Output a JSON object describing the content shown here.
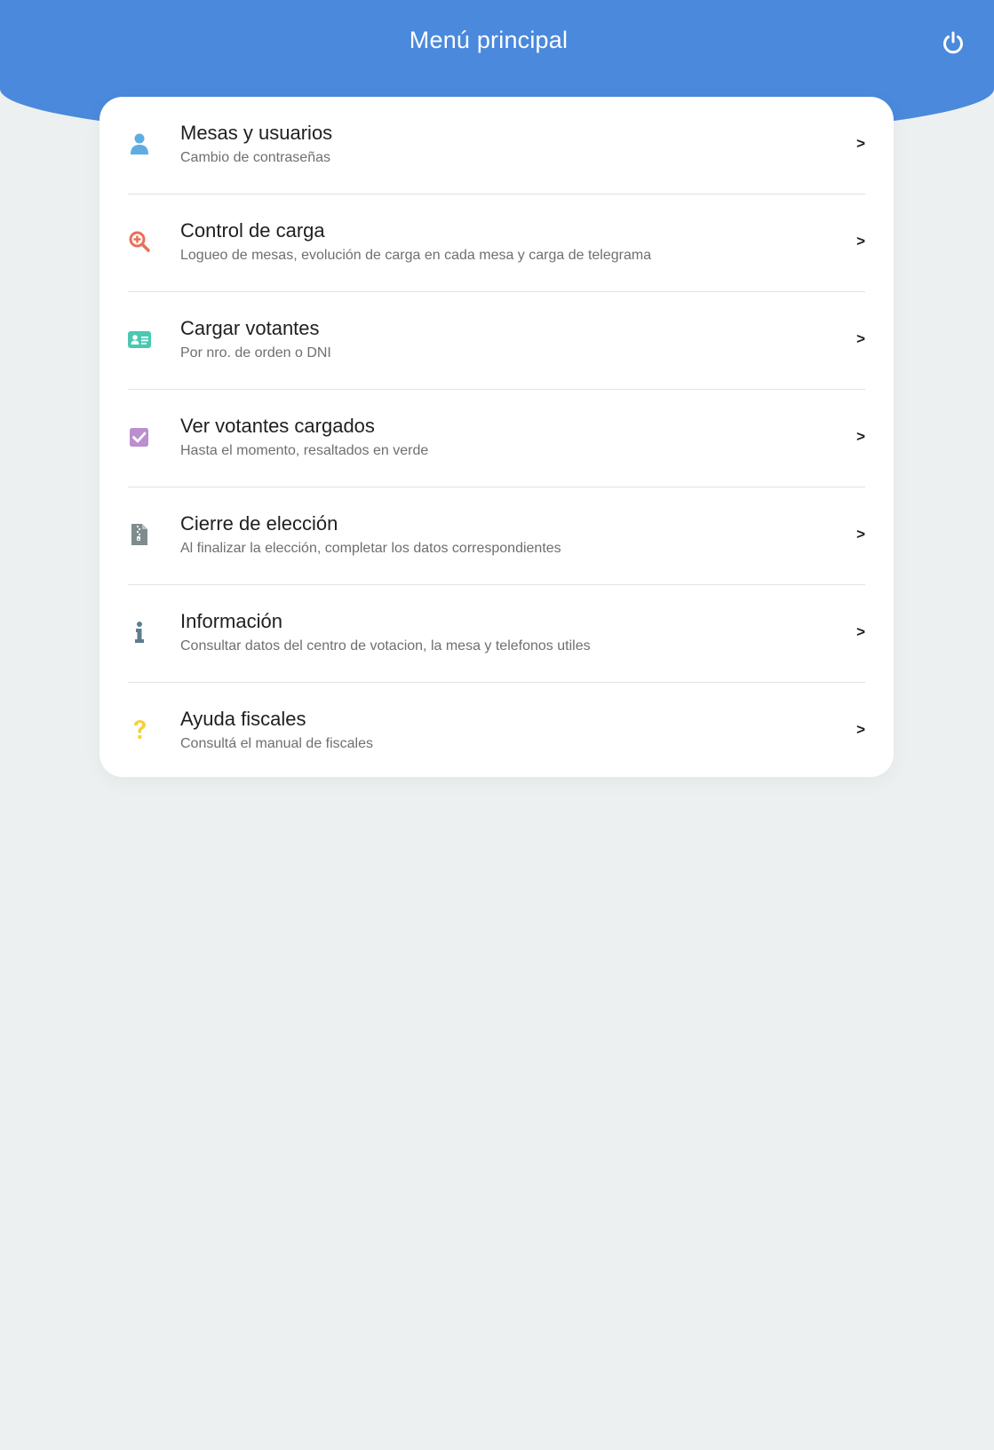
{
  "header": {
    "title": "Menú principal",
    "background": "#4A89DC",
    "power_icon": "power-icon"
  },
  "background_color": "#ECF0F1",
  "menu": {
    "arrow": ">",
    "items": [
      {
        "title": "Mesas y usuarios",
        "subtitle": "Cambio de contraseñas",
        "icon": "user-icon",
        "icon_color": "#5DADE2"
      },
      {
        "title": "Control de carga",
        "subtitle": "Logueo de mesas, evolución de carga en cada mesa y carga de telegrama",
        "icon": "search-plus-icon",
        "icon_color": "#E8705A"
      },
      {
        "title": "Cargar votantes",
        "subtitle": "Por nro. de orden o DNI",
        "icon": "id-card-icon",
        "icon_color": "#48C9B0"
      },
      {
        "title": "Ver votantes cargados",
        "subtitle": "Hasta el momento, resaltados en verde",
        "icon": "check-square-icon",
        "icon_color": "#BB8FCE"
      },
      {
        "title": "Cierre de elección",
        "subtitle": "Al finalizar la elección, completar los datos correspondientes",
        "icon": "file-archive-icon",
        "icon_color": "#7F8C8D"
      },
      {
        "title": "Información",
        "subtitle": "Consultar datos del centro de votacion, la mesa y telefonos utiles",
        "icon": "info-icon",
        "icon_color": "#5D7E91"
      },
      {
        "title": "Ayuda fiscales",
        "subtitle": "Consultá el manual de fiscales",
        "icon": "question-icon",
        "icon_color": "#F4D03F"
      }
    ]
  }
}
